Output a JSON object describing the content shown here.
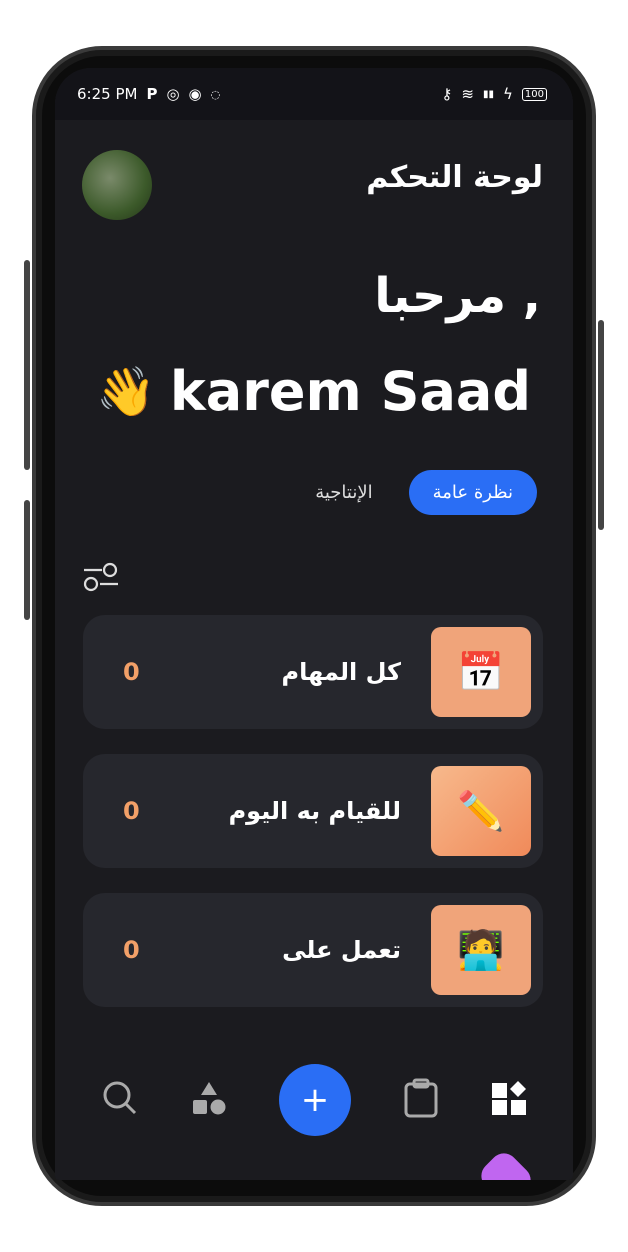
{
  "status_bar": {
    "time": "6:25 PM",
    "battery": "100"
  },
  "header": {
    "title": "لوحة التحكم"
  },
  "greeting": {
    "hello": "مرحبا ,",
    "name": "karem Saad",
    "emoji": "👋"
  },
  "tabs": [
    {
      "label": "نظرة عامة",
      "active": true
    },
    {
      "label": "الإنتاجية",
      "active": false
    }
  ],
  "cards": [
    {
      "label": "كل المهام",
      "count": "0",
      "image": "calendar-illustration"
    },
    {
      "label": "للقيام به اليوم",
      "count": "0",
      "image": "pencil-cup-illustration"
    },
    {
      "label": "تعمل على",
      "count": "0",
      "image": "multitasking-illustration"
    }
  ],
  "colors": {
    "accent": "#2a6ef5",
    "count": "#f2a068",
    "card": "#26272d",
    "background": "#1b1b1f"
  }
}
